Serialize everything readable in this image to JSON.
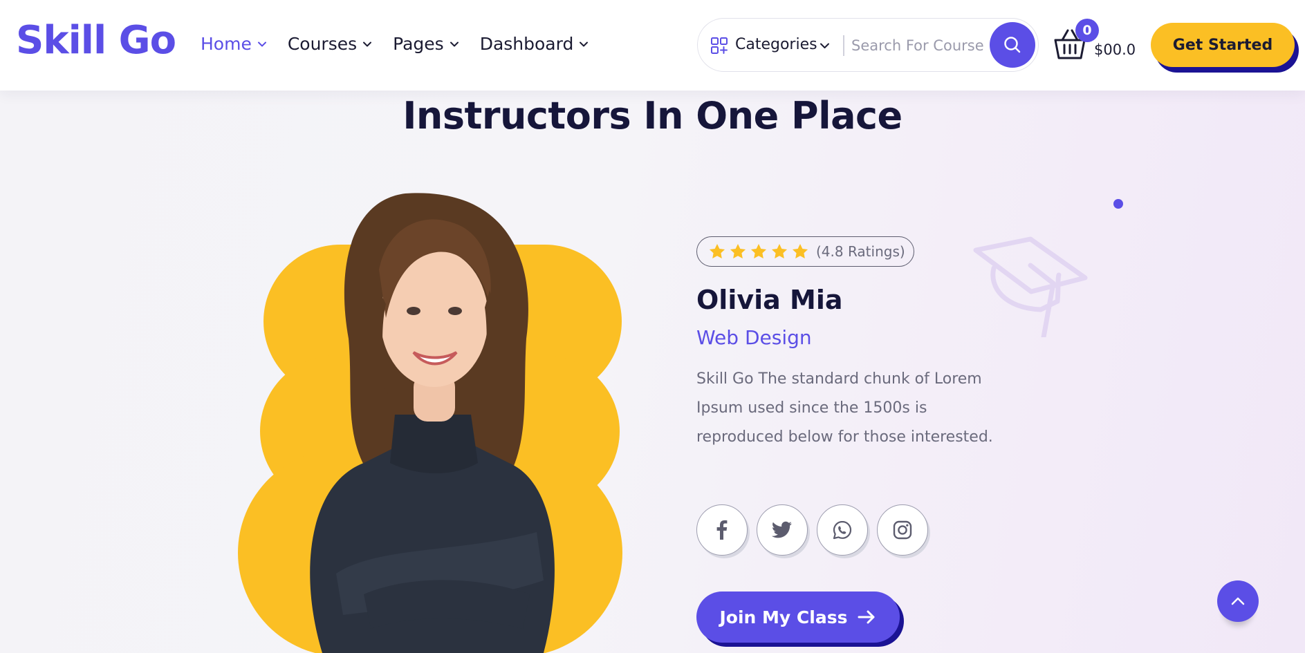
{
  "header": {
    "logo": "Skill Go",
    "nav": [
      {
        "label": "Home",
        "active": true
      },
      {
        "label": "Courses",
        "active": false
      },
      {
        "label": "Pages",
        "active": false
      },
      {
        "label": "Dashboard",
        "active": false
      }
    ],
    "search": {
      "category_label": "Categories",
      "placeholder": "Search For Course",
      "value": ""
    },
    "cart": {
      "count": "0",
      "total": "$00.0"
    },
    "cta_label": "Get Started"
  },
  "section": {
    "title": "Instructors In One Place"
  },
  "instructor": {
    "rating_stars": 5,
    "rating_text": "(4.8 Ratings)",
    "name": "Olivia Mia",
    "role": "Web Design",
    "description": "Skill Go The standard chunk of Lorem Ipsum used since the 1500s is reproduced below for those interested.",
    "socials": [
      "facebook-icon",
      "twitter-icon",
      "whatsapp-icon",
      "instagram-icon"
    ],
    "join_label": "Join My Class"
  },
  "colors": {
    "brand": "#5b4ee6",
    "accent_yellow": "#fbbf24",
    "dark_navy": "#1b1394",
    "heading": "#16163a"
  }
}
